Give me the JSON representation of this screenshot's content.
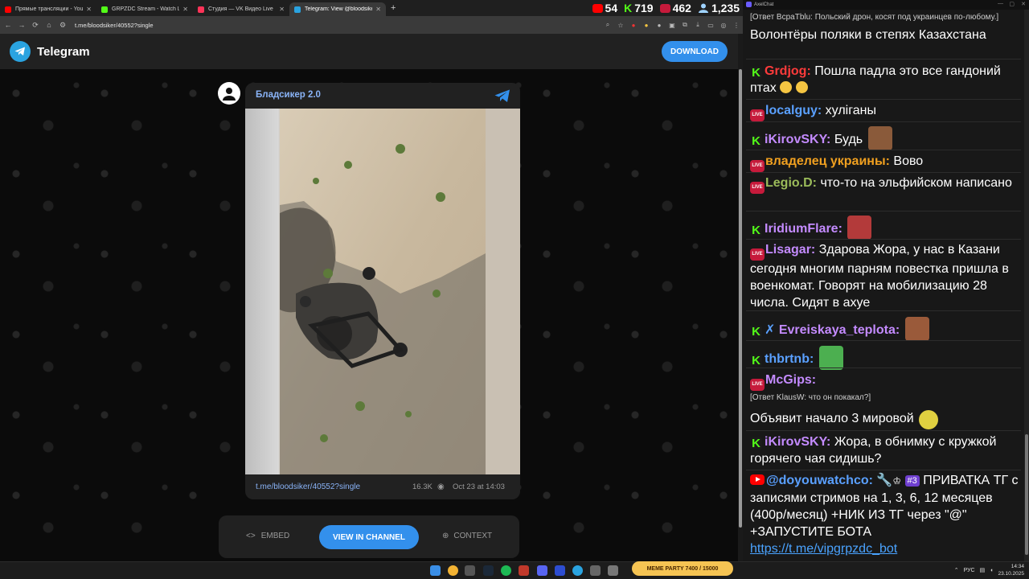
{
  "browser": {
    "tabs": [
      {
        "title": "Прямые трансляции - YouTube",
        "color": "#ff0000"
      },
      {
        "title": "GRPZDC Stream - Watch Live o",
        "color": "#53fc18"
      },
      {
        "title": "Студия — VK Видео Live",
        "color": "#ff3358"
      },
      {
        "title": "Telegram: View @bloodsiker",
        "color": "#2aa3e0"
      }
    ],
    "new_tab": "+",
    "url": "t.me/bloodsiker/40552?single",
    "stats": [
      {
        "platform": "youtube-icon",
        "value": "54",
        "color": "#ff0000"
      },
      {
        "platform": "kick-icon",
        "value": "719",
        "color": "#53fc18"
      },
      {
        "platform": "live-icon",
        "value": "462",
        "color": "#c61a3b"
      },
      {
        "platform": "viewers-icon",
        "value": "1,235",
        "color": "#9fd3ff"
      }
    ]
  },
  "telegram": {
    "brand": "Telegram",
    "download": "DOWNLOAD",
    "post": {
      "channel_name": "Бладсикер 2.0",
      "link": "t.me/bloodsiker/40552?single",
      "views": "16.3K",
      "date": "Oct 23 at 14:03"
    },
    "actions": {
      "embed": "EMBED",
      "embed_icon": "<>",
      "view": "VIEW IN CHANNEL",
      "context": "CONTEXT"
    }
  },
  "chat": {
    "title": "AxelChat",
    "messages": [
      {
        "reply": "[Ответ ВсраТblu: Польский дрон, косят под украинцев по-любому.]",
        "text": "Волонтёры поляки в степях Казахстана"
      },
      {
        "nick": "Grdjog:",
        "text": " Пошла падла это все гандоний птах"
      },
      {
        "nick": "localguy:",
        "text": " хулiганы"
      },
      {
        "nick": "iKirovSKY:",
        "text": " Будь"
      },
      {
        "nick": "владелец украины:",
        "text": " Вово"
      },
      {
        "nick": "Legio.D:",
        "text": " что-то на эльфийском написано"
      },
      {
        "nick": "IridiumFlare:",
        "text": ""
      },
      {
        "nick": "Lisagar:",
        "text": " Здарова Жора, у нас в Казани сегодня многим парням повестка пришла в военкомат. Говорят на мобилизацию 28 числа. Сидят в ахуе"
      },
      {
        "nick": "Evreiskaya_teplota:",
        "text": ""
      },
      {
        "nick": "thbrtnb:",
        "text": ""
      },
      {
        "nick": "McGips:",
        "reply": "[Ответ KlausW: что он покакал?]",
        "text": "Объявит начало 3 мировой"
      },
      {
        "nick": "iKirovSKY:",
        "text": " Жора, в обнимку с кружкой горячего чая сидишь?"
      },
      {
        "nick": "@doyouwatchco:",
        "badge": "#3",
        "text": " ПРИВАТКА ТГ с записями стримов на 1, 3, 6, 12 месяцев (400р/месяц) +НИК ИЗ ТГ через \"@\" +ЗАПУСТИТЕ БОТА",
        "link": "https://t.me/vipgrpzdc_bot"
      }
    ]
  },
  "taskbar": {
    "widget": "MEME PARTY 7400 / 15000",
    "lang": "РУС",
    "time": "14:34",
    "date": "23.10.2025"
  }
}
